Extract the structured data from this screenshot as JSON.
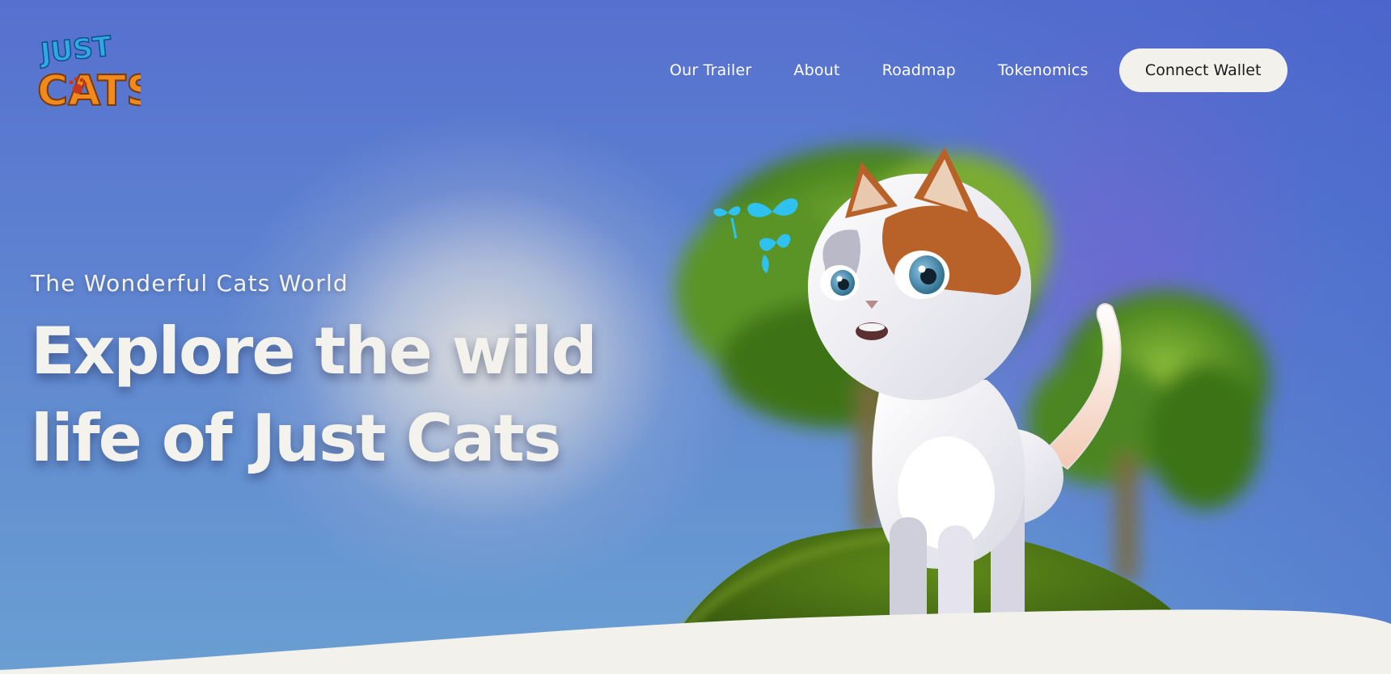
{
  "brand": {
    "logo_line1": "JUST",
    "logo_line2": "CATS"
  },
  "nav": {
    "links": [
      "Our Trailer",
      "About",
      "Roadmap",
      "Tokenomics"
    ],
    "wallet_button": "Connect Wallet"
  },
  "hero": {
    "subtitle": "The Wonderful Cats World",
    "title": "Explore the wild life of Just Cats"
  },
  "colors": {
    "sky_top": "#5670cf",
    "sky_bottom": "#6a9fd2",
    "cream": "#f3f1ec",
    "logo_blue": "#2fa8e6",
    "logo_orange": "#f08a1c",
    "cat_orange": "#b8622a"
  }
}
